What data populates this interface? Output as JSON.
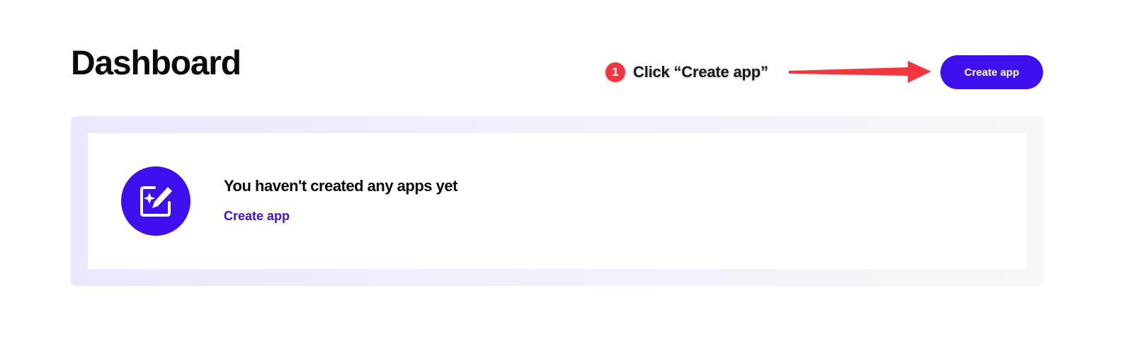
{
  "header": {
    "title": "Dashboard",
    "create_button_label": "Create app"
  },
  "annotation": {
    "step_number": "1",
    "instruction": "Click “Create app”",
    "colors": {
      "badge": "#f2363f",
      "arrow": "#f2363f"
    }
  },
  "empty_state": {
    "icon": "edit-sparkle-icon",
    "heading": "You haven't created any apps yet",
    "link_label": "Create app"
  },
  "colors": {
    "accent": "#3f0ff0",
    "text": "#0b0b0b",
    "panel_tint": "#ece7fd"
  }
}
